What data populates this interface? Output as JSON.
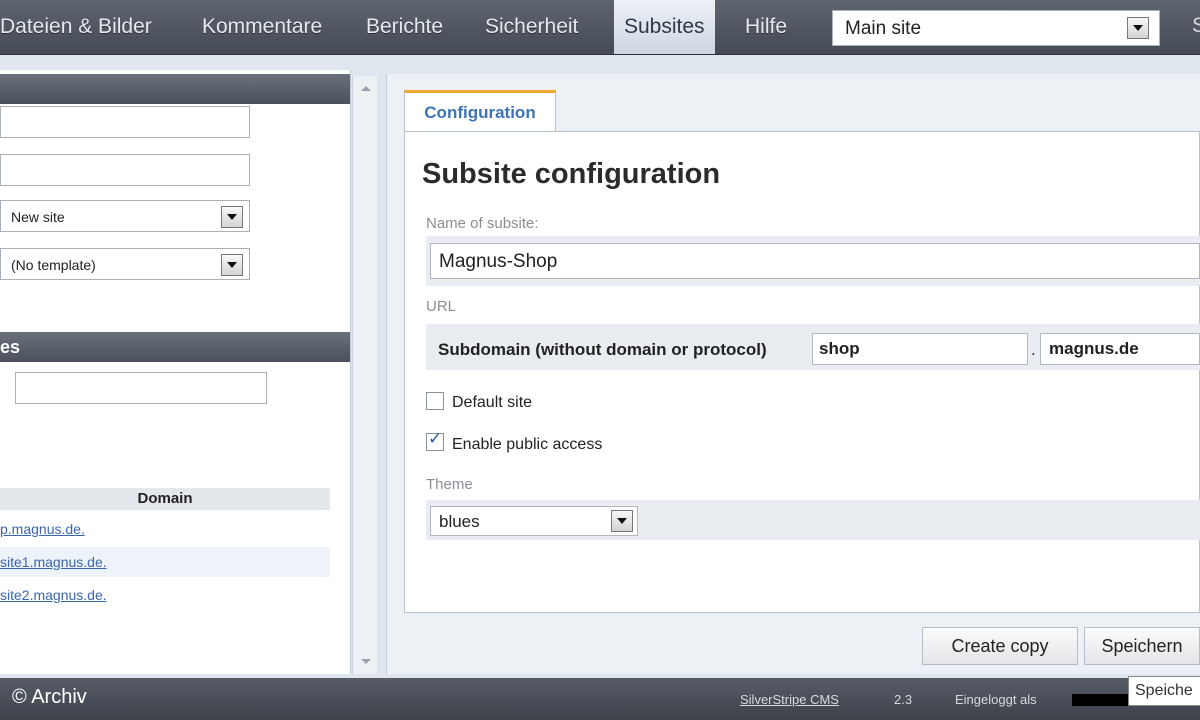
{
  "nav": {
    "items": [
      "Dateien & Bilder",
      "Kommentare",
      "Berichte",
      "Sicherheit",
      "Subsites",
      "Hilfe"
    ],
    "active": "Subsites",
    "site_select": "Main site",
    "cut_item": "S"
  },
  "left": {
    "header2": "es",
    "select1": "New site",
    "select2": "(No template)",
    "domain_header": "Domain",
    "domains": [
      "p.magnus.de.",
      "site1.magnus.de.",
      "site2.magnus.de."
    ]
  },
  "main": {
    "tab": "Configuration",
    "title": "Subsite configuration",
    "name_label": "Name of subsite:",
    "name_value": "Magnus-Shop",
    "url_label": "URL",
    "subdomain_label": "Subdomain (without domain or protocol)",
    "subdomain_value": "shop",
    "dot": ".",
    "domain_value": "magnus.de",
    "default_site_label": "Default site",
    "default_site_checked": false,
    "public_access_label": "Enable public access",
    "public_access_checked": true,
    "theme_label": "Theme",
    "theme_value": "blues",
    "create_copy": "Create copy",
    "save": "Speichern"
  },
  "footer": {
    "copyright": "© Archiv",
    "cms_link": "SilverStripe CMS",
    "version": "2.3",
    "logged_in": "Eingeloggt als",
    "tooltip": "Speiche"
  },
  "colors": {
    "tab_accent": "#f0a830",
    "link": "#3a66b0",
    "nav_bg": "#4f5560"
  }
}
